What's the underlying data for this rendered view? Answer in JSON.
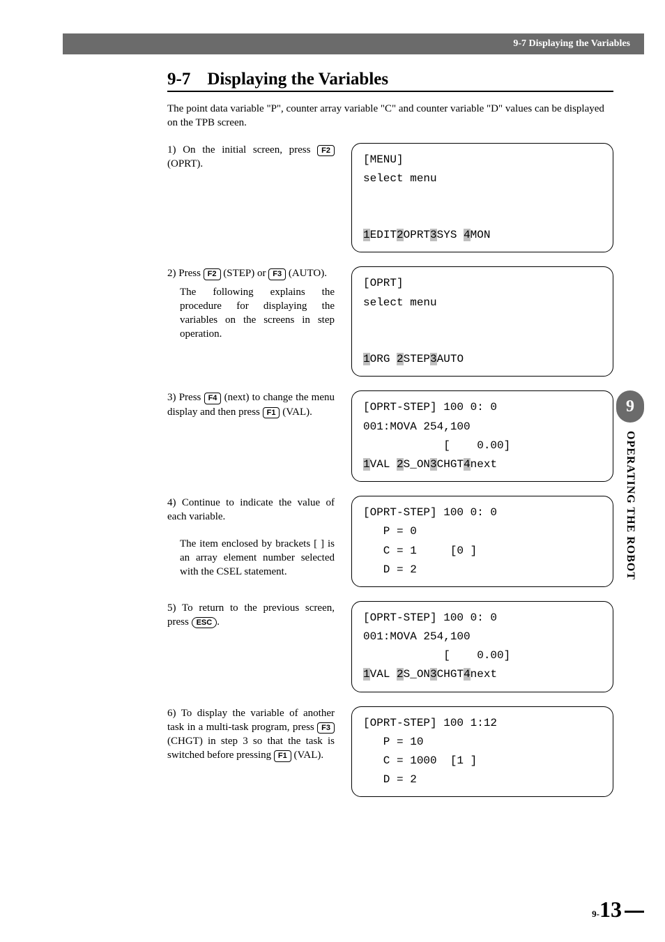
{
  "header": {
    "breadcrumb": "9-7 Displaying the Variables"
  },
  "section": {
    "number": "9-7",
    "title": "Displaying the Variables"
  },
  "intro": "The point data variable \"P\", counter array variable \"C\" and counter variable \"D\" values can be displayed on the TPB screen.",
  "steps": {
    "s1": {
      "n": "1)",
      "pre": "On the initial screen, press ",
      "k1": "F2",
      "post": " (OPRT)."
    },
    "s2": {
      "n": "2)",
      "pre": "Press ",
      "k1": "F2",
      "mid1": " (STEP) or ",
      "k2": "F3",
      "post": " (AUTO).",
      "extra": "The following explains the procedure for displaying the variables on the screens in step operation."
    },
    "s3": {
      "n": "3)",
      "pre": "Press ",
      "k1": "F4",
      "mid1": " (next) to change the menu display and then press ",
      "k2": "F1",
      "post": " (VAL)."
    },
    "s4": {
      "n": "4)",
      "main": "Continue to indicate the value of each variable.",
      "extra": "The item enclosed by brackets [  ] is an array element number selected with the CSEL statement."
    },
    "s5": {
      "n": "5)",
      "pre": "To return to the previous screen, press ",
      "k1": "ESC",
      "post": "."
    },
    "s6": {
      "n": "6)",
      "pre": "To display the variable of another task in a multi-task program, press ",
      "k1": "F3",
      "mid1": " (CHGT) in step 3 so that the task is switched before pressing ",
      "k2": "F1",
      "post": " (VAL)."
    }
  },
  "screens": {
    "sc1": {
      "l1": "[MENU]",
      "l2": "select menu",
      "edit": "EDIT",
      "oprt": "OPRT",
      "sys": "SYS ",
      "mon": "MON"
    },
    "sc2": {
      "l1": "[OPRT]",
      "l2": "select menu",
      "org": "ORG ",
      "step": "STEP",
      "auto": "AUTO"
    },
    "sc3": {
      "l1": "[OPRT-STEP] 100 0: 0",
      "l2": "001:MOVA 254,100",
      "l3": "            [    0.00]",
      "val": "VAL ",
      "son": "S_ON",
      "chgt": "CHGT",
      "next": "next"
    },
    "sc4": {
      "l1": "[OPRT-STEP] 100 0: 0",
      "l2": "   P = 0",
      "l3": "   C = 1     [0 ]",
      "l4": "   D = 2"
    },
    "sc5": {
      "l1": "[OPRT-STEP] 100 0: 0",
      "l2": "001:MOVA 254,100",
      "l3": "            [    0.00]",
      "val": "VAL ",
      "son": "S_ON",
      "chgt": "CHGT",
      "next": "next"
    },
    "sc6": {
      "l1": "[OPRT-STEP] 100 1:12",
      "l2": "   P = 10",
      "l3": "   C = 1000  [1 ]",
      "l4": "   D = 2"
    }
  },
  "sidebar": {
    "chapter": "9",
    "label": "OPERATING THE ROBOT"
  },
  "page": {
    "prefix": "9-",
    "num": "13"
  }
}
